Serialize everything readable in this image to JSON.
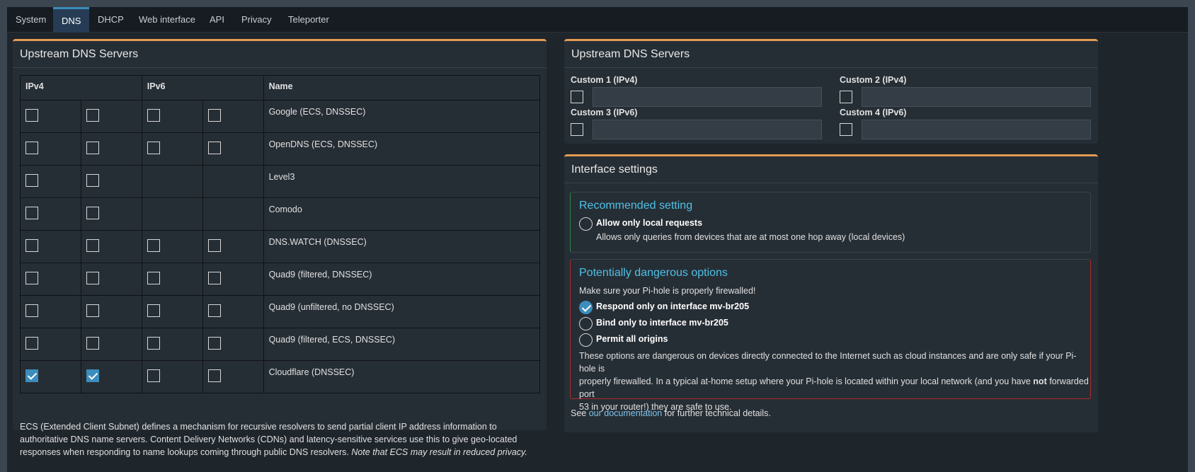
{
  "tabs": [
    "System",
    "DNS",
    "DHCP",
    "Web interface",
    "API",
    "Privacy",
    "Teleporter"
  ],
  "active_tab": "DNS",
  "left_panel": {
    "title": "Upstream DNS Servers",
    "headers": {
      "ipv4": "IPv4",
      "ipv6": "IPv6",
      "name": "Name"
    },
    "rows": [
      {
        "name": "Google (ECS, DNSSEC)",
        "v4a": false,
        "v4b": false,
        "v6a": false,
        "v6b": false,
        "has_v6": true
      },
      {
        "name": "OpenDNS (ECS, DNSSEC)",
        "v4a": false,
        "v4b": false,
        "v6a": false,
        "v6b": false,
        "has_v6": true
      },
      {
        "name": "Level3",
        "v4a": false,
        "v4b": false,
        "has_v6": false
      },
      {
        "name": "Comodo",
        "v4a": false,
        "v4b": false,
        "has_v6": false
      },
      {
        "name": "DNS.WATCH (DNSSEC)",
        "v4a": false,
        "v4b": false,
        "v6a": false,
        "v6b": false,
        "has_v6": true
      },
      {
        "name": "Quad9 (filtered, DNSSEC)",
        "v4a": false,
        "v4b": false,
        "v6a": false,
        "v6b": false,
        "has_v6": true
      },
      {
        "name": "Quad9 (unfiltered, no DNSSEC)",
        "v4a": false,
        "v4b": false,
        "v6a": false,
        "v6b": false,
        "has_v6": true
      },
      {
        "name": "Quad9 (filtered, ECS, DNSSEC)",
        "v4a": false,
        "v4b": false,
        "v6a": false,
        "v6b": false,
        "has_v6": true
      },
      {
        "name": "Cloudflare (DNSSEC)",
        "v4a": true,
        "v4b": true,
        "v6a": false,
        "v6b": false,
        "has_v6": true
      }
    ],
    "ecs_text": "ECS (Extended Client Subnet) defines a mechanism for recursive resolvers to send partial client IP address information to authoritative DNS name servers. Content Delivery Networks (CDNs) and latency-sensitive services use this to give geo-located responses when responding to name lookups coming through public DNS resolvers.",
    "ecs_note": "Note that ECS may result in reduced privacy."
  },
  "right_panel": {
    "title": "Upstream DNS Servers",
    "custom": [
      {
        "label": "Custom 1 (IPv4)",
        "value": ""
      },
      {
        "label": "Custom 2 (IPv4)",
        "value": ""
      },
      {
        "label": "Custom 3 (IPv6)",
        "value": ""
      },
      {
        "label": "Custom 4 (IPv6)",
        "value": ""
      }
    ]
  },
  "interface_panel": {
    "title": "Interface settings",
    "recommended_title": "Recommended setting",
    "local_label": "Allow only local requests",
    "local_desc": "Allows only queries from devices that are at most one hop away (local devices)",
    "danger_title": "Potentially dangerous options",
    "danger_warning": "Make sure your Pi-hole is properly firewalled!",
    "opt_respond": "Respond only on interface mv-br205",
    "opt_bind": "Bind only to interface mv-br205",
    "opt_permit": "Permit all origins",
    "danger_desc_1": "These options are dangerous on devices directly connected to the Internet such as cloud instances and are only safe if your Pi-hole is",
    "danger_desc_2a": "properly firewalled. In a typical at-home setup where your Pi-hole is located within your local network (and you have ",
    "danger_desc_not": "not",
    "danger_desc_2b": " forwarded port",
    "danger_desc_3": "53 in your router!) they are safe to use.",
    "see_prefix": "See ",
    "see_link": "our documentation",
    "see_suffix": " for further technical details."
  },
  "colors": {
    "accent": "#3c8dbc",
    "panel_top_border": "#e39b52",
    "recommended_border": "#2a8a3e",
    "danger_border": "#b02a2a",
    "box_title": "#4ec1e6"
  }
}
